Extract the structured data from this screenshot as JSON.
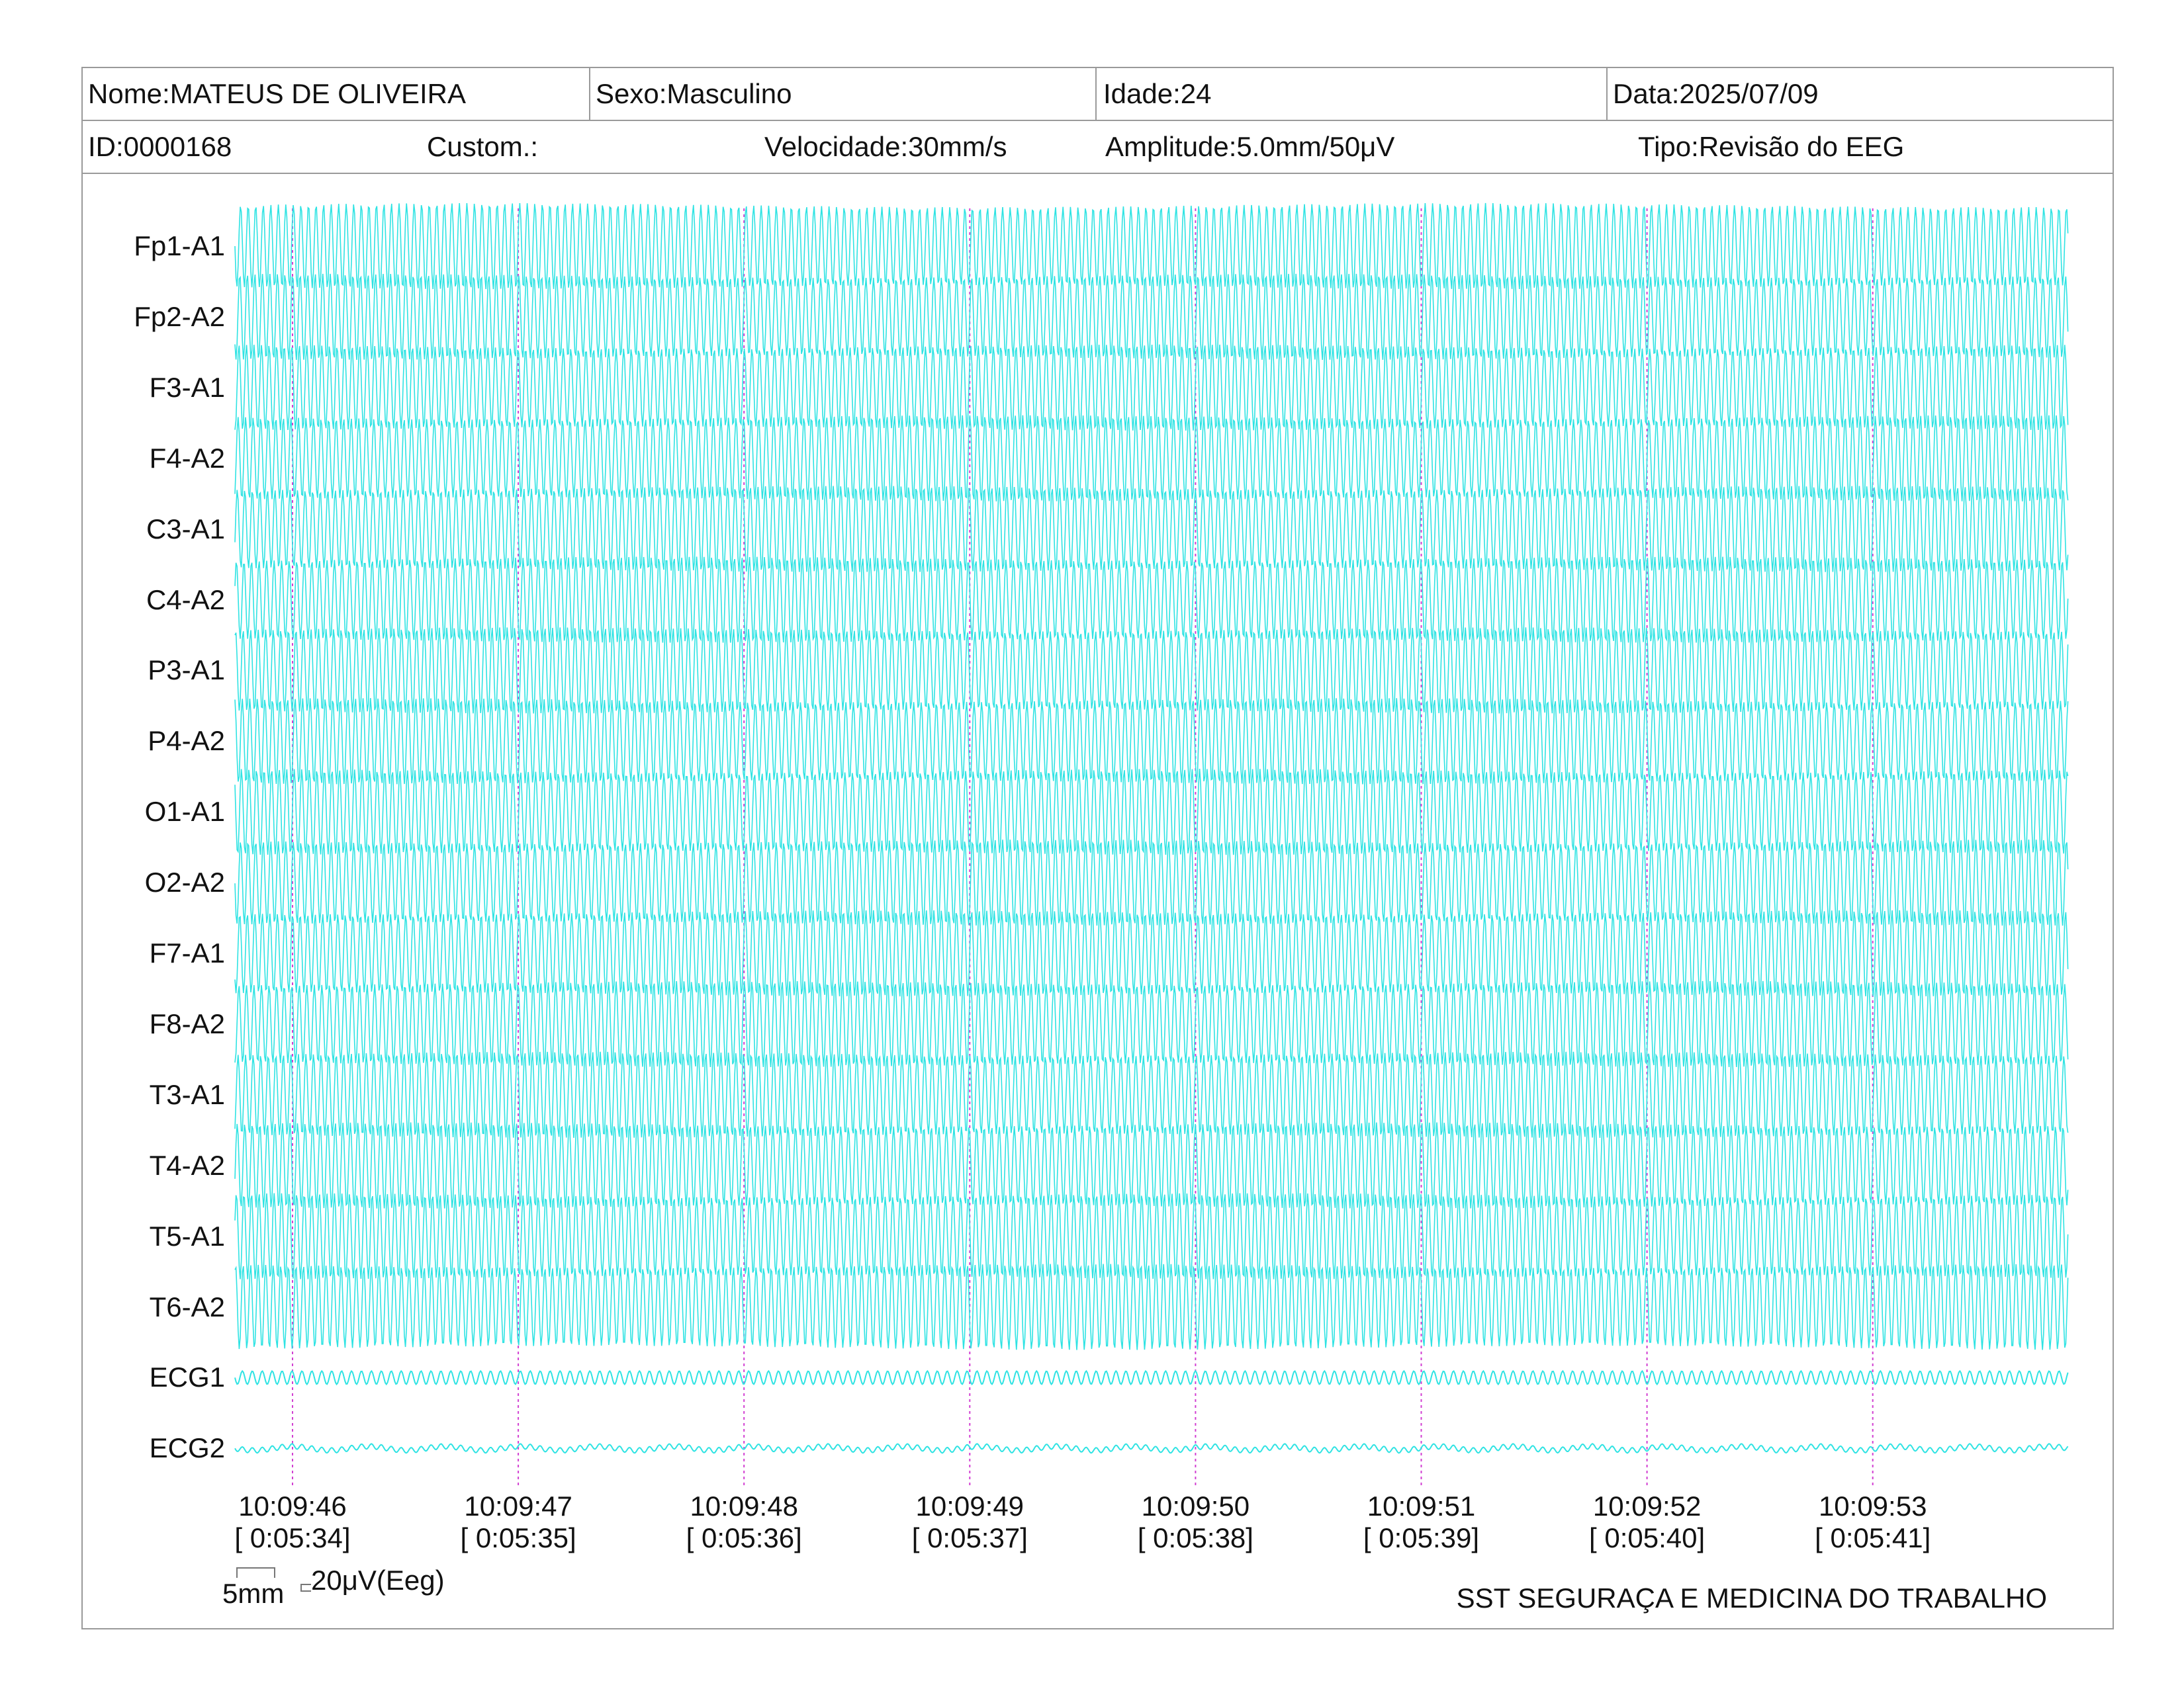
{
  "header": {
    "name": "Nome:MATEUS DE OLIVEIRA",
    "sex": "Sexo:Masculino",
    "age": "Idade:24",
    "date": "Data:2025/07/09",
    "id": "ID:0000168",
    "custom": "Custom.:",
    "speed": "Velocidade:30mm/s",
    "amplitude": "Amplitude:5.0mm/50μV",
    "type": "Tipo:Revisão do EEG"
  },
  "chart_data": {
    "type": "line",
    "channels": [
      "Fp1-A1",
      "Fp2-A2",
      "F3-A1",
      "F4-A2",
      "C3-A1",
      "C4-A2",
      "P3-A1",
      "P4-A2",
      "O1-A1",
      "O2-A2",
      "F7-A1",
      "F8-A2",
      "T3-A1",
      "T4-A2",
      "T5-A1",
      "T6-A2",
      "ECG1",
      "ECG2"
    ],
    "time_labels": [
      "10:09:46",
      "10:09:47",
      "10:09:48",
      "10:09:49",
      "10:09:50",
      "10:09:51",
      "10:09:52",
      "10:09:53"
    ],
    "elapsed_labels": [
      "[ 0:05:34]",
      "[ 0:05:35]",
      "[ 0:05:36]",
      "[ 0:05:37]",
      "[ 0:05:38]",
      "[ 0:05:39]",
      "[ 0:05:40]",
      "[ 0:05:41]"
    ],
    "trace_color": "#2fe3e3",
    "marker_color": "#d23fd2"
  },
  "scale": {
    "time_label": "5mm",
    "amp_label": "20μV(Eeg)"
  },
  "footer": {
    "company": "SST SEGURAÇA E MEDICINA DO TRABALHO"
  }
}
